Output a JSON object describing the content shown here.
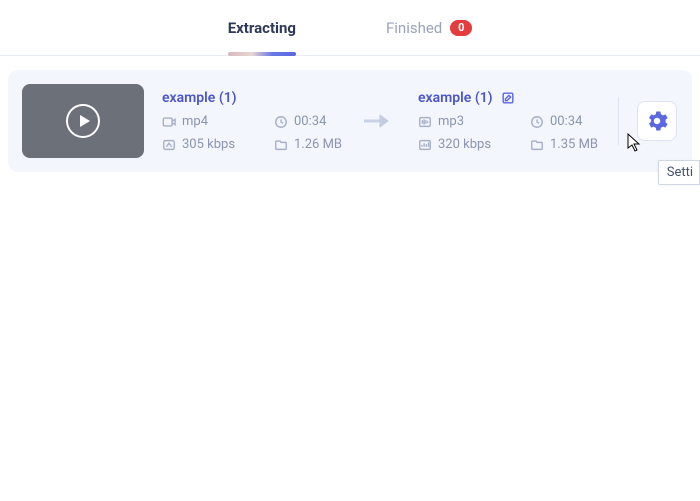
{
  "tabs": {
    "extracting": {
      "label": "Extracting",
      "active": true
    },
    "finished": {
      "label": "Finished",
      "count": "0",
      "active": false
    }
  },
  "item": {
    "source": {
      "name": "example (1)",
      "format": "mp4",
      "duration": "00:34",
      "bitrate": "305 kbps",
      "size": "1.26 MB"
    },
    "target": {
      "name": "example (1)",
      "format": "mp3",
      "duration": "00:34",
      "bitrate": "320 kbps",
      "size": "1.35 MB"
    }
  },
  "tooltip": "Setti"
}
